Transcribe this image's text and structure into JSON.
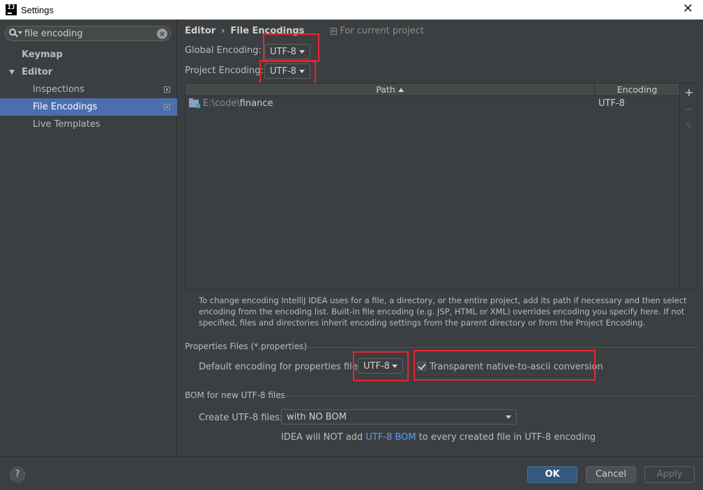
{
  "window": {
    "app_icon_text": "IJ",
    "title": "Settings",
    "close_glyph": "✕"
  },
  "sidebar": {
    "search": {
      "value": "file encoding",
      "clear_glyph": "×"
    },
    "items": [
      {
        "label": "Keymap",
        "bold": true
      },
      {
        "label": "Editor",
        "bold": true,
        "expanded": true
      },
      {
        "label": "Inspections"
      },
      {
        "label": "File Encodings",
        "selected": true
      },
      {
        "label": "Live Templates"
      }
    ]
  },
  "header": {
    "crumb1": "Editor",
    "separator": "›",
    "crumb2": "File Encodings",
    "scope": "For current project"
  },
  "encoding": {
    "global_label": "Global Encoding:",
    "global_value": "UTF-8",
    "project_label": "Project Encoding:",
    "project_value": "UTF-8"
  },
  "table": {
    "columns": [
      "Path",
      "Encoding"
    ],
    "rows": [
      {
        "path_prefix": "E:\\code\\",
        "path_name": "finance",
        "encoding": "UTF-8"
      }
    ],
    "tools": {
      "add": "+",
      "remove": "−",
      "edit": "✎"
    }
  },
  "info_text": "To change encoding IntelliJ IDEA uses for a file, a directory, or the entire project, add its path if necessary and then select encoding from the encoding list. Built-in file encoding (e.g. JSP, HTML or XML) overrides encoding you specify here. If not specified, files and directories inherit encoding settings from the parent directory or from the Project Encoding.",
  "properties": {
    "group_title": "Properties Files (*.properties)",
    "default_label": "Default encoding for properties files:",
    "default_value": "UTF-8",
    "native_ascii_label": "Transparent native-to-ascii conversion",
    "native_ascii_checked": true
  },
  "bom": {
    "group_title": "BOM for new UTF-8 files",
    "create_label": "Create UTF-8 files:",
    "create_value": "with NO BOM",
    "note_before": "IDEA will NOT add ",
    "note_link": "UTF-8 BOM",
    "note_after": " to every created file in UTF-8 encoding"
  },
  "footer": {
    "help_label": "?",
    "ok_label": "OK",
    "cancel_label": "Cancel",
    "apply_label": "Apply"
  },
  "colors": {
    "background": "#3c3f41",
    "selection": "#4b6eaf",
    "highlight_box": "#e8262c",
    "link": "#589df6",
    "ok_button": "#365880"
  }
}
